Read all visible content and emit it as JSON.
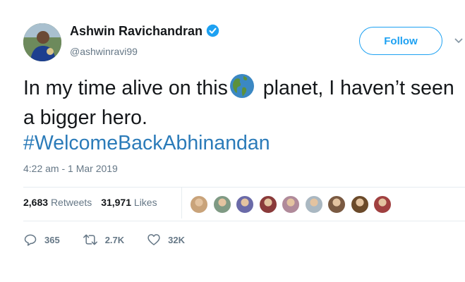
{
  "author": {
    "name": "Ashwin Ravichandran",
    "handle": "@ashwinravi99",
    "verified": true
  },
  "follow_label": "Follow",
  "tweet": {
    "text_part1": "In my time alive on this",
    "text_part2": " planet, I haven’t seen a bigger hero.",
    "hashtag": "#WelcomeBackAbhinandan",
    "emoji_icon": "globe-americas-icon"
  },
  "timestamp": "4:22 am - 1 Mar 2019",
  "stats": {
    "retweets_count": "2,683",
    "retweets_label": "Retweets",
    "likes_count": "31,971",
    "likes_label": "Likes"
  },
  "likers": [
    {
      "color": "#c9a37a"
    },
    {
      "color": "#7f9a84"
    },
    {
      "color": "#6a6aa8"
    },
    {
      "color": "#8a3a3a"
    },
    {
      "color": "#b08a9a"
    },
    {
      "color": "#aab8c2"
    },
    {
      "color": "#7a5a42"
    },
    {
      "color": "#6b4a2a"
    },
    {
      "color": "#a04040"
    }
  ],
  "actions": {
    "reply_count": "365",
    "retweet_count": "2.7K",
    "like_count": "32K"
  },
  "colors": {
    "accent": "#1da1f2",
    "hashtag": "#2b7bb9",
    "muted": "#657786"
  }
}
